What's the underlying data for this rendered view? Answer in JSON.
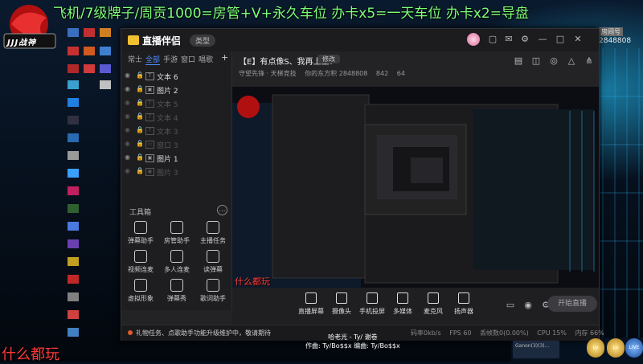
{
  "overlay": {
    "top_text": "飞机/7级牌子/周贡1000=房管+V+永久车位 办卡x5=一天车位 办卡x2=导盘",
    "bottom_left_text": "什么都玩",
    "mid_red_text": "什么都玩",
    "ticker_line1": "哈老光 - Ty/ 谢卷",
    "ticker_line2": "作曲: Ty/Bo$$x    编曲: Ty/Bo$$x",
    "logo_text": "JJJ战神"
  },
  "right_info": {
    "room_tag": "房间号",
    "room_number": "2848808"
  },
  "window": {
    "brand": "直播伴侣",
    "mode_pill": "类型",
    "title_icons": [
      "skin-icon",
      "mail-icon",
      "settings-icon",
      "minimize-icon",
      "maximize-icon",
      "close-icon"
    ]
  },
  "left_panel": {
    "tabs": [
      "常士",
      "全部",
      "手游",
      "窗口",
      "唱歌"
    ],
    "active_tab": 1,
    "add_label": "+",
    "layers": [
      {
        "name": "文本 6",
        "type": "T",
        "dim": false
      },
      {
        "name": "图片 2",
        "type": "▣",
        "dim": false
      },
      {
        "name": "文本 5",
        "type": "T",
        "dim": true
      },
      {
        "name": "文本 4",
        "type": "T",
        "dim": true
      },
      {
        "name": "文本 3",
        "type": "T",
        "dim": true
      },
      {
        "name": "窗口 3",
        "type": "▭",
        "dim": true
      },
      {
        "name": "图片 1",
        "type": "▣",
        "dim": false
      },
      {
        "name": "图片 3",
        "type": "▣",
        "dim": true
      }
    ],
    "toolbox_title": "工具箱",
    "toolbox_more": "…",
    "tools": [
      {
        "label": "弹幕助手",
        "icon": "danmaku-helper-icon"
      },
      {
        "label": "房管助手",
        "icon": "admin-helper-icon"
      },
      {
        "label": "主播任务",
        "icon": "task-icon"
      },
      {
        "label": "视频连麦",
        "icon": "video-link-icon"
      },
      {
        "label": "多人连麦",
        "icon": "multi-link-icon"
      },
      {
        "label": "读弹幕",
        "icon": "read-danmaku-icon"
      },
      {
        "label": "虚拟形象",
        "icon": "avatar-icon"
      },
      {
        "label": "弹幕秀",
        "icon": "danmaku-show-icon"
      },
      {
        "label": "歌词助手",
        "icon": "lyrics-icon"
      }
    ]
  },
  "header": {
    "room_title": "【E】有点像S、我再上上?",
    "modify_label": "修改",
    "meta": [
      "守望先锋 · 天梯竞技",
      "你的东方积 2848808",
      "842",
      "64"
    ]
  },
  "controls": [
    {
      "label": "直播屏幕",
      "icon": "screen-icon"
    },
    {
      "label": "摄像头",
      "icon": "camera-icon"
    },
    {
      "label": "手机投屏",
      "icon": "phone-cast-icon"
    },
    {
      "label": "多媒体",
      "icon": "media-icon"
    },
    {
      "label": "麦克风",
      "icon": "mic-icon"
    },
    {
      "label": "扬声器",
      "icon": "speaker-icon"
    }
  ],
  "live_button": "开始直播",
  "status": {
    "message": "礼物任务、点歌助手功能升级维护中，敬请期待",
    "stats": [
      "码率0kb/s",
      "FPS 60",
      "丢帧数0(0.00%)",
      "CPU 15%",
      "内存 66%"
    ]
  },
  "bottom_right": {
    "card_name": "Ganon(3)(3)...",
    "badges": [
      "Lv",
      "Lv",
      "LIVE"
    ]
  }
}
